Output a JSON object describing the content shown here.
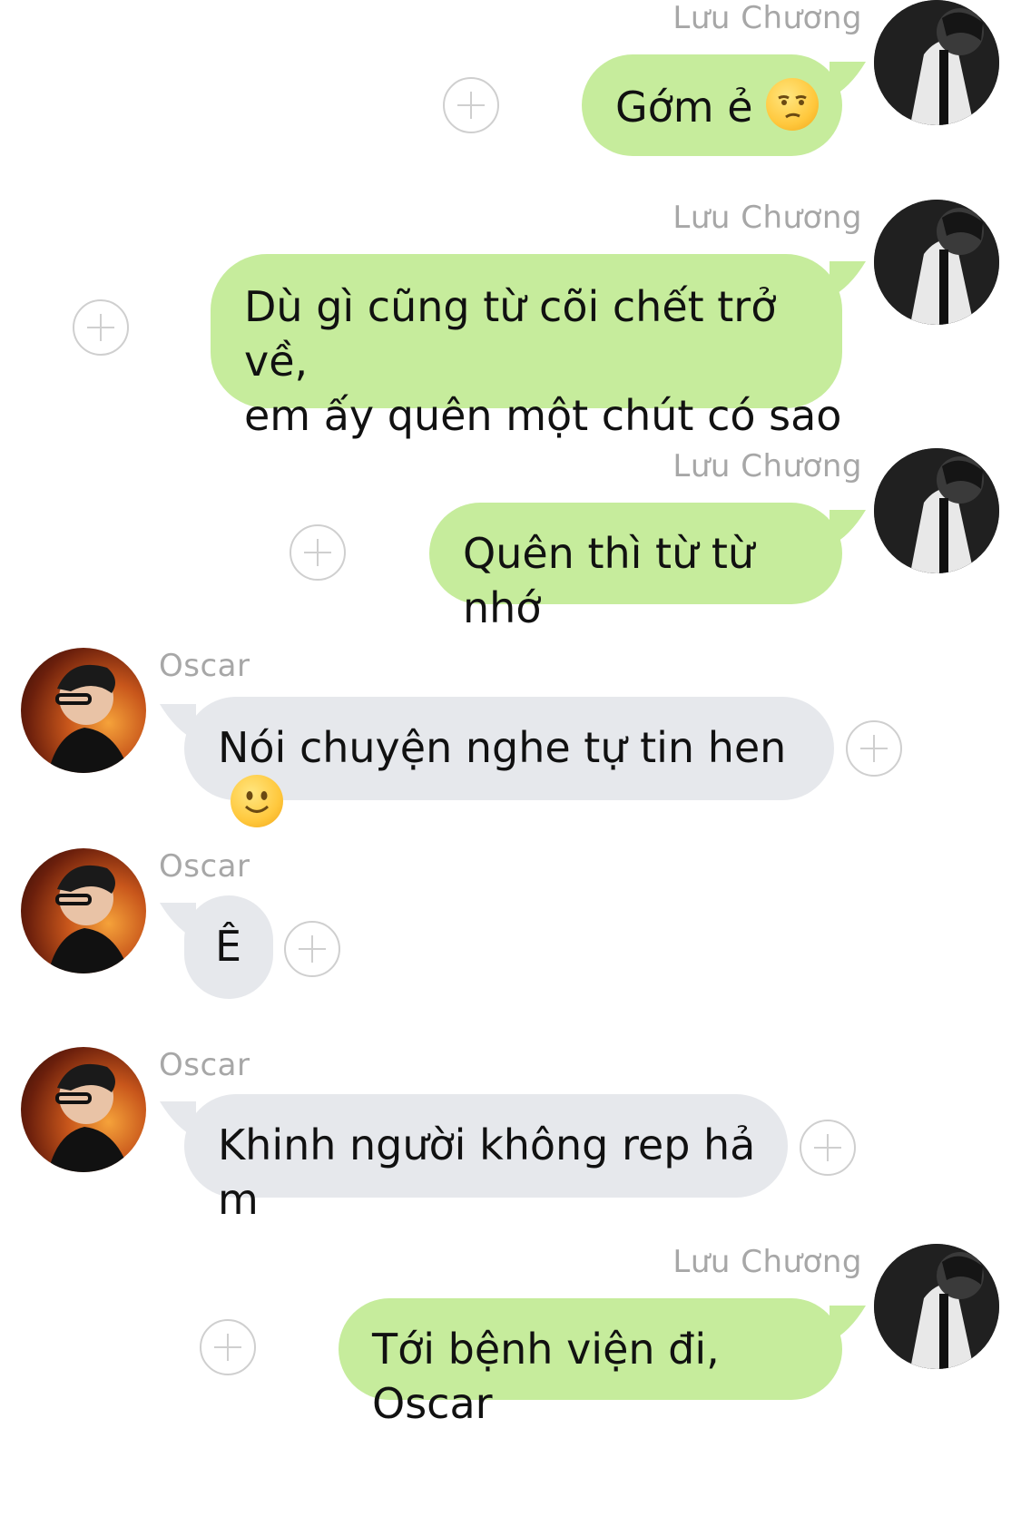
{
  "colors": {
    "outgoing_bubble": "#c6ec9c",
    "incoming_bubble": "#e6e8ec",
    "sender_name": "#a7a7a7",
    "add_icon": "#cfcfcf"
  },
  "messages": [
    {
      "direction": "outgoing",
      "sender": "Lưu Chương",
      "text": "Gớm ẻ",
      "emoji": "unamused-face-icon"
    },
    {
      "direction": "outgoing",
      "sender": "Lưu Chương",
      "text": "Dù gì cũng từ cõi chết trở về,\nem ấy quên một chút có sao"
    },
    {
      "direction": "outgoing",
      "sender": "Lưu Chương",
      "text": "Quên thì từ từ nhớ"
    },
    {
      "direction": "incoming",
      "sender": "Oscar",
      "text": "Nói chuyện nghe tự tin hen",
      "emoji": "slightly-smiling-face-icon"
    },
    {
      "direction": "incoming",
      "sender": "Oscar",
      "text": "Ê"
    },
    {
      "direction": "incoming",
      "sender": "Oscar",
      "text": "Khinh người không rep hả m"
    },
    {
      "direction": "outgoing",
      "sender": "Lưu Chương",
      "text": "Tới bệnh viện đi, Oscar"
    }
  ]
}
